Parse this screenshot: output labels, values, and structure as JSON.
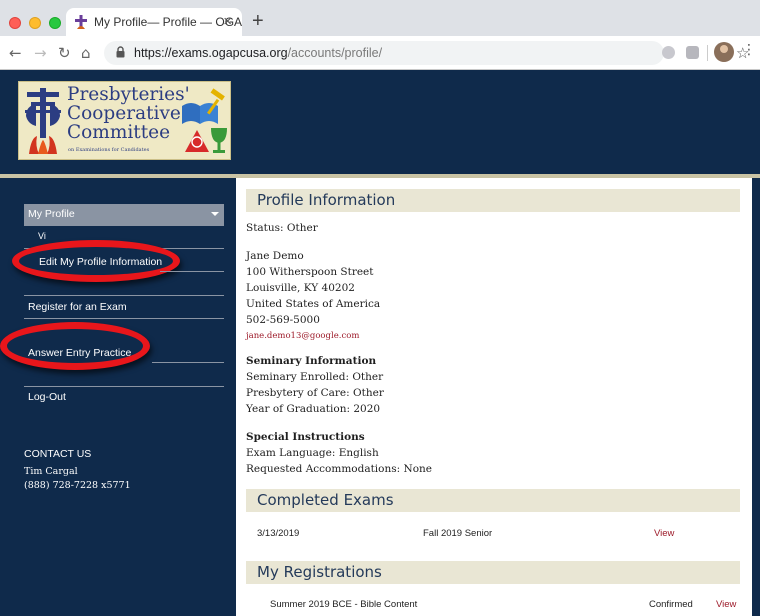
{
  "browser": {
    "tab_title": "My Profile— Profile — OGA",
    "tab_close": "×",
    "new_tab": "+",
    "url_domain": "https://exams.ogapcusa.org",
    "url_path": "/accounts/profile/",
    "icons": [
      "back-icon",
      "forward-icon",
      "reload-icon",
      "home-icon",
      "lock-icon",
      "star-icon",
      "extension-icon",
      "drive-icon",
      "profile-avatar",
      "menu-icon"
    ]
  },
  "logo": {
    "line1": "Presbyteries'",
    "line2": "Cooperative",
    "line3": "Committee",
    "subtitle": "on Examinations for Candidates"
  },
  "sidebar": {
    "active_item": "My Profile",
    "hidden_item": "Vi",
    "edit_profile": "Edit My Profile Information",
    "register": "Register for an Exam",
    "answer_practice": "Answer Entry Practice",
    "logout": "Log-Out",
    "contact_title": "CONTACT US",
    "contact_name": "Tim Cargal",
    "contact_phone": "(888) 728-7228 x5771"
  },
  "profile": {
    "heading": "Profile Information",
    "status": "Status: Other",
    "name": "Jane Demo",
    "street": "100 Witherspoon Street",
    "city": "Louisville, KY 40202",
    "country": "United States of America",
    "phone": "502-569-5000",
    "email": "jane.demo13@google.com",
    "seminary_heading": "Seminary Information",
    "seminary_enrolled": "Seminary Enrolled: Other",
    "presbytery": "Presbytery of Care: Other",
    "graduation": "Year of Graduation: 2020",
    "special_heading": "Special Instructions",
    "language": "Exam Language: English",
    "accommodations": "Requested Accommodations: None"
  },
  "completed_exams": {
    "heading": "Completed Exams",
    "rows": [
      {
        "date": "3/13/2019",
        "exam": "Fall 2019 Senior",
        "action": "View"
      }
    ]
  },
  "registrations": {
    "heading": "My Registrations",
    "rows": [
      {
        "exam": "Summer 2019 BCE - Bible Content",
        "status": "Confirmed",
        "action": "View"
      }
    ]
  },
  "colors": {
    "navy": "#0f2a4b",
    "section_bg": "#e9e6d4",
    "link_red": "#9d1b2a",
    "highlight_red": "#e8161b"
  }
}
